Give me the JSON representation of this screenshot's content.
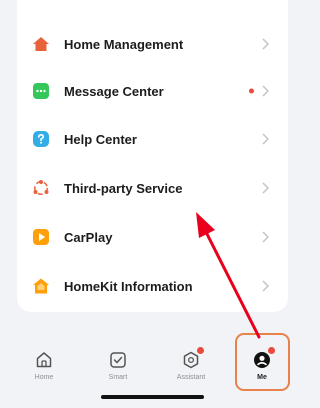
{
  "menu": {
    "items": [
      {
        "label": "Home Management",
        "icon": "house-icon",
        "color": "#e8623c",
        "has_badge": false
      },
      {
        "label": "Message Center",
        "icon": "chat-bubble-icon",
        "color": "#34c759",
        "has_badge": true
      },
      {
        "label": "Help Center",
        "icon": "question-icon",
        "color": "#32ade6",
        "has_badge": false
      },
      {
        "label": "Third-party Service",
        "icon": "integration-icon",
        "color": "#e8623c",
        "has_badge": false
      },
      {
        "label": "CarPlay",
        "icon": "carplay-icon",
        "color": "#ff9f0a",
        "has_badge": false
      },
      {
        "label": "HomeKit Information",
        "icon": "homekit-icon",
        "color": "#ff9f0a",
        "has_badge": false
      }
    ]
  },
  "tabbar": {
    "tabs": [
      {
        "label": "Home",
        "icon": "home-tab-icon",
        "active": false,
        "badge": false
      },
      {
        "label": "Smart",
        "icon": "smart-tab-icon",
        "active": false,
        "badge": false
      },
      {
        "label": "Assistant",
        "icon": "assistant-tab-icon",
        "active": false,
        "badge": true
      },
      {
        "label": "Me",
        "icon": "me-tab-icon",
        "active": true,
        "badge": true
      }
    ]
  },
  "colors": {
    "badge": "#e84b3c",
    "annotation": "#e8001c",
    "highlight_box": "#e8824c"
  }
}
